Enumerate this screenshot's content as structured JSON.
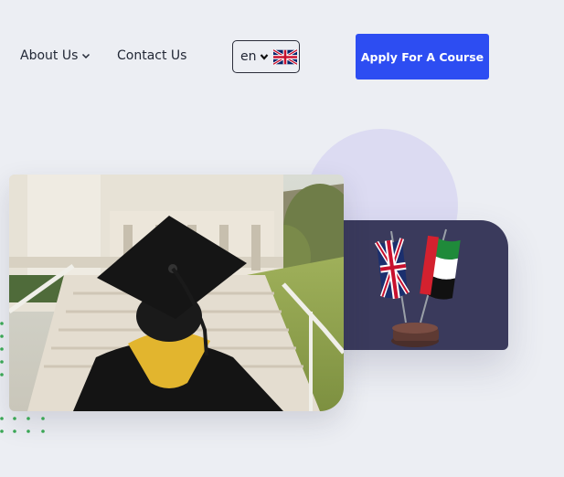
{
  "nav": {
    "about": "About Us",
    "contact": "Contact Us"
  },
  "language": {
    "selected": "en",
    "flag_icon": "uk-flag-icon"
  },
  "cta": {
    "label": "Apply For A Course"
  },
  "colors": {
    "background": "#eceef3",
    "accent": "#2d4df2",
    "flag_card": "#3a3a5c",
    "blob": "#dcdbf2",
    "dots": "#3aa655"
  }
}
